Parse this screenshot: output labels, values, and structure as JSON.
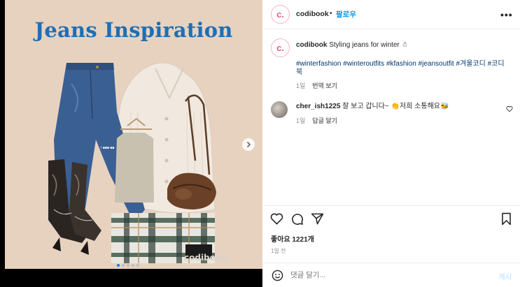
{
  "post": {
    "image": {
      "title": "Jeans Inspiration",
      "watermark": "codibook"
    },
    "header": {
      "avatar_letter": "c.",
      "username": "codibook",
      "separator": "•",
      "follow_label": "팔로우",
      "more_icon": "more-icon",
      "more_label": "•••"
    },
    "caption": {
      "avatar_letter": "c.",
      "username": "codibook",
      "text": "Styling jeans for winter ☃",
      "hashtags": "#winterfashion #winteroutfits #kfashion #jeansoutfit #겨울코디 #코디북",
      "age": "1일",
      "translate_label": "번역 보기"
    },
    "comments": [
      {
        "username": "cher_ish1225",
        "text": "잘 보고 갑니다~ 👏저희 소통해요🐝",
        "age": "1일",
        "reply_label": "답글 달기"
      }
    ],
    "actions": {
      "like_icon": "heart-icon",
      "comment_icon": "comment-icon",
      "share_icon": "share-icon",
      "save_icon": "bookmark-icon"
    },
    "likes": "좋아요 1221개",
    "timestamp": "1일 전",
    "comment_box": {
      "placeholder": "댓글 달기...",
      "post_label": "게시"
    },
    "carousel": {
      "current": 1,
      "total": 5
    }
  },
  "colors": {
    "accent": "#0095f6",
    "title_blue": "#1f6fb3",
    "photo_bg": "#e7d2c0",
    "post_disabled": "#b2dffc"
  }
}
